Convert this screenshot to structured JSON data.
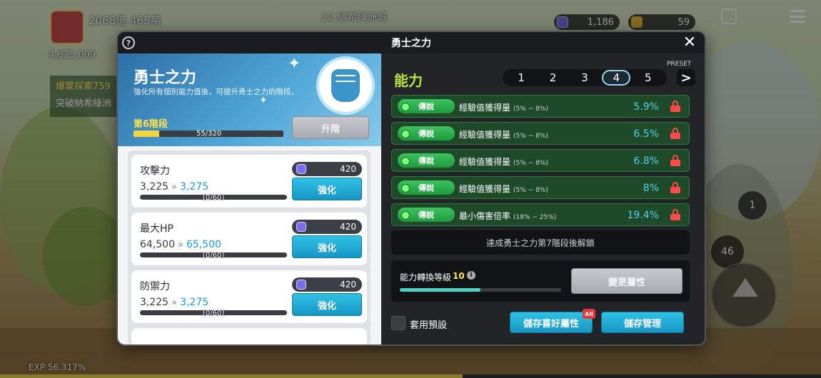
{
  "hud": {
    "power": "2068億 465萬",
    "region": "22.納希綠洲城",
    "gem_count": "1,186",
    "gold_count": "59",
    "gold_left": "4,625,009",
    "quest_line1": "爆覽探索759",
    "quest_line2": "突破納希綠洲",
    "exp": "EXP 56.317%",
    "button_1": "1",
    "button_46": "46"
  },
  "modal": {
    "title": "勇士之力",
    "help": "?",
    "close": "✕"
  },
  "left": {
    "title": "勇士之力",
    "desc": "強化所有個別能力值後，可提升勇士之力的階段。",
    "stage": "第6階段",
    "stage_progress": "55/320",
    "stage_fraction": 0.172,
    "upgrade_label": "升階",
    "stats": [
      {
        "name": "攻擊力",
        "current": "3,225",
        "next": "3,275",
        "progress": "[0/60]",
        "cost": "420",
        "button": "強化"
      },
      {
        "name": "最大HP",
        "current": "64,500",
        "next": "65,500",
        "progress": "[0/60]",
        "cost": "420",
        "button": "強化"
      },
      {
        "name": "防禦力",
        "current": "3,225",
        "next": "3,275",
        "progress": "[0/60]",
        "cost": "420",
        "button": "強化"
      }
    ]
  },
  "right": {
    "title": "能力",
    "preset_label": "PRESET",
    "presets": [
      "1",
      "2",
      "3",
      "4",
      "5"
    ],
    "active_preset": "4",
    "preset_next": ">",
    "abilities": [
      {
        "grade": "傳說",
        "name": "經驗值獲得量",
        "range": "(5% ~ 8%)",
        "value": "5.9%"
      },
      {
        "grade": "傳說",
        "name": "經驗值獲得量",
        "range": "(5% ~ 8%)",
        "value": "6.5%"
      },
      {
        "grade": "傳說",
        "name": "經驗值獲得量",
        "range": "(5% ~ 8%)",
        "value": "6.8%"
      },
      {
        "grade": "傳說",
        "name": "經驗值獲得量",
        "range": "(5% ~ 8%)",
        "value": "8%"
      },
      {
        "grade": "傳說",
        "name": "最小傷害倍率",
        "range": "(18% ~ 25%)",
        "value": "19.4%"
      }
    ],
    "unlock_text": "達成勇士之力第7階段後解鎖",
    "convert_label": "能力轉換等級",
    "convert_level": "10",
    "convert_fraction": 0.5,
    "change_attr": "變更屬性",
    "preset_apply": "套用預設",
    "save_fav": "儲存喜好屬性",
    "all_badge": "All",
    "save_manage": "儲存管理"
  },
  "colors": {
    "ability_green": "#b9e63a",
    "value_cyan": "#4fd1e6",
    "lock_red": "#ff4a4a",
    "button_blue": "#1697c4"
  }
}
